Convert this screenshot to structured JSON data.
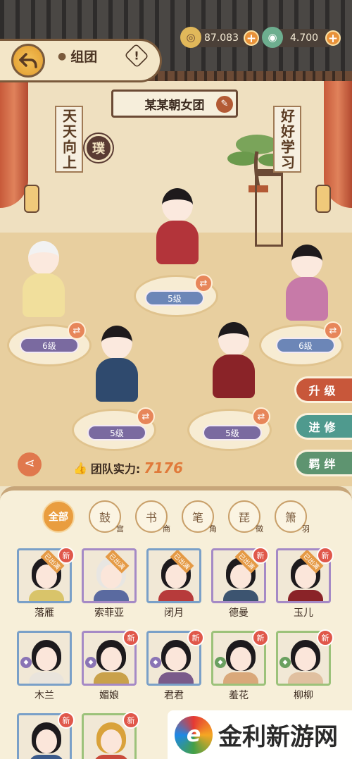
{
  "header": {
    "location_label": "组团",
    "help_label": "!",
    "coins": "87.083",
    "jade": "4.700",
    "plus": "+"
  },
  "group": {
    "name": "某某朝女团",
    "left_scroll": "天天向上",
    "right_scroll": "好好学习",
    "seal": "璞"
  },
  "members": [
    {
      "level": "6级"
    },
    {
      "level": "5级"
    },
    {
      "level": "6级"
    },
    {
      "level": "5级"
    },
    {
      "level": "5级"
    }
  ],
  "side_actions": {
    "upgrade": "升级",
    "advance": "进修",
    "bond": "羁绊"
  },
  "team_power": {
    "label": "团队实力:",
    "value": "7176"
  },
  "filters": [
    {
      "label": "全部",
      "sub": ""
    },
    {
      "label": "鼓",
      "sub": "宫"
    },
    {
      "label": "书",
      "sub": "商"
    },
    {
      "label": "笔",
      "sub": "角"
    },
    {
      "label": "琵",
      "sub": "徵"
    },
    {
      "label": "箫",
      "sub": "羽"
    }
  ],
  "characters": [
    {
      "name": "落雁",
      "new": "新",
      "tag": "已出演",
      "frame": "blue"
    },
    {
      "name": "索菲亚",
      "new": "",
      "tag": "已出演",
      "frame": "purple"
    },
    {
      "name": "闭月",
      "new": "",
      "tag": "已出演",
      "frame": "blue"
    },
    {
      "name": "德曼",
      "new": "新",
      "tag": "已出演",
      "frame": "purple"
    },
    {
      "name": "玉儿",
      "new": "新",
      "tag": "已出演",
      "frame": "purple"
    },
    {
      "name": "木兰",
      "new": "",
      "tag": "",
      "frame": "blue"
    },
    {
      "name": "媚娘",
      "new": "新",
      "tag": "",
      "frame": "purple"
    },
    {
      "name": "君君",
      "new": "新",
      "tag": "",
      "frame": "blue"
    },
    {
      "name": "羞花",
      "new": "新",
      "tag": "",
      "frame": "green"
    },
    {
      "name": "柳柳",
      "new": "新",
      "tag": "",
      "frame": "green"
    },
    {
      "name": "",
      "new": "新",
      "tag": "",
      "frame": "blue"
    },
    {
      "name": "",
      "new": "新",
      "tag": "",
      "frame": "green"
    }
  ],
  "watermark": {
    "logo": "e",
    "text": "金利新游网"
  },
  "colors": {
    "accent": "#e99d3f",
    "upgrade": "#c8573a",
    "advance": "#4f9a8e",
    "bond": "#5e9470"
  }
}
